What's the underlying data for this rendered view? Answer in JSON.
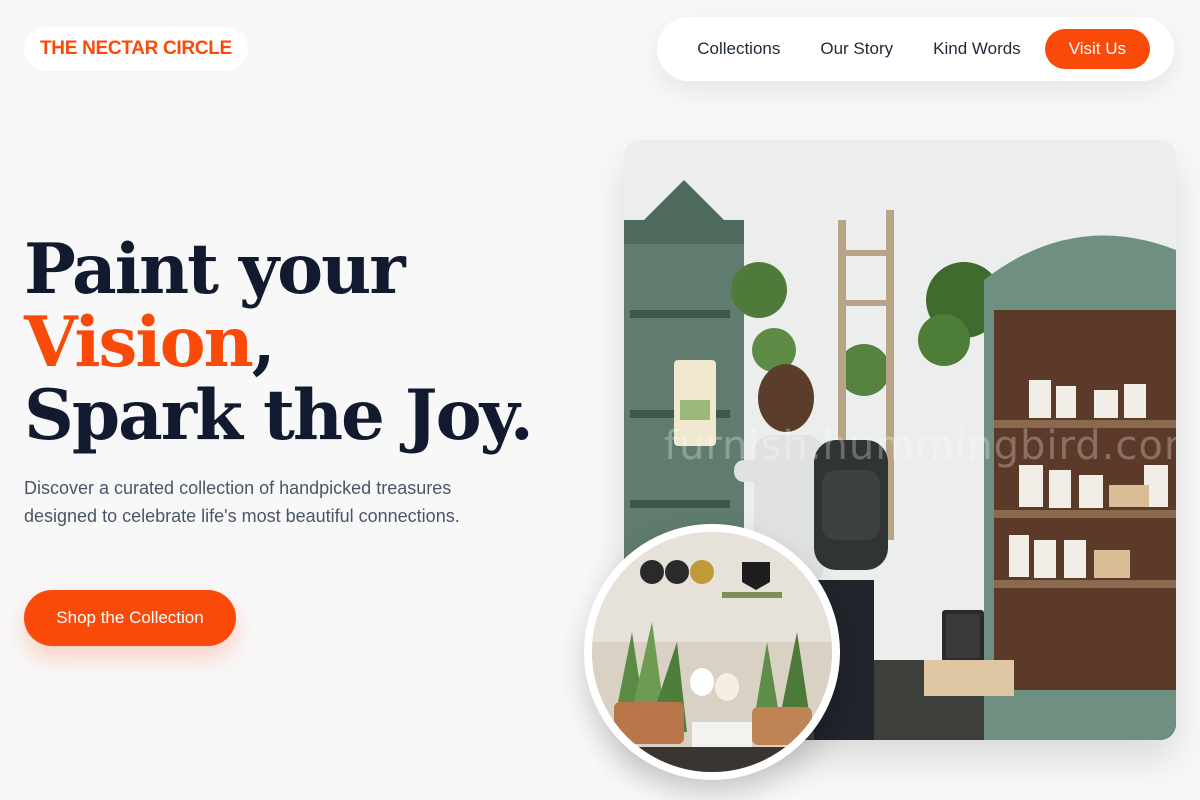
{
  "brand": {
    "name": "THE NECTAR CIRCLE"
  },
  "nav": {
    "links": [
      "Collections",
      "Our Story",
      "Kind Words"
    ],
    "cta": "Visit Us"
  },
  "hero": {
    "line1": "Paint your",
    "accent_word": "Vision",
    "accent_punct": ",",
    "line3": "Spark the Joy.",
    "subtitle": "Discover a curated collection of handpicked treasures designed to celebrate life's most beautiful connections.",
    "cta": "Shop the Collection"
  },
  "images": {
    "main_watermark": "furnish.hummingbird.com",
    "main_label": "shop-interior-photo",
    "circle_label": "plants-and-goods-photo"
  },
  "colors": {
    "accent": "#fa4a0a",
    "heading": "#111a2e",
    "body_text": "#4a5568",
    "background": "#f8f8f8"
  }
}
